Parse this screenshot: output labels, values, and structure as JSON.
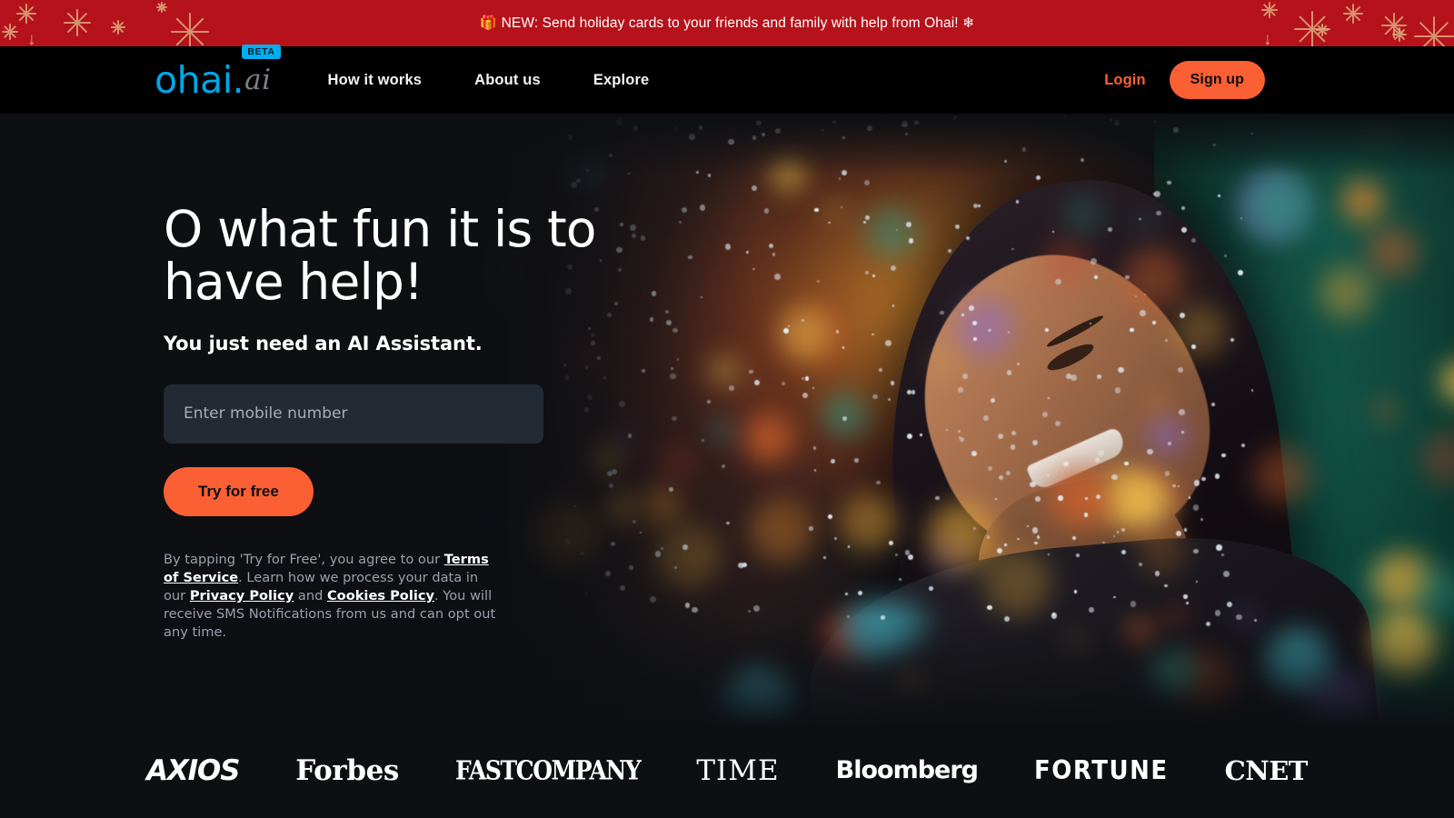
{
  "promo": {
    "icon_left": "gift-icon",
    "text": "🎁 NEW: Send holiday cards to your friends and family with help from Ohai! ❄",
    "background": "#b5121b",
    "decoration_color": "#dca97e"
  },
  "nav": {
    "logo": {
      "name": "ohai",
      "suffix": ".ai",
      "badge": "BETA",
      "brand_color": "#00a7e6",
      "badge_color": "#00aeef"
    },
    "links": [
      {
        "label": "How it works"
      },
      {
        "label": "About us"
      },
      {
        "label": "Explore"
      }
    ],
    "login_label": "Login",
    "signup_label": "Sign up",
    "accent_color": "#fb5f34"
  },
  "hero": {
    "headline": "O what fun it is to\nhave help!",
    "subhead": "You just need an AI Assistant.",
    "phone_placeholder": "Enter mobile number",
    "phone_value": "",
    "cta_label": "Try for free",
    "legal": {
      "part1": "By tapping 'Try for Free', you agree to our ",
      "link1": "Terms of Service",
      "part2": ". Learn how we process your data in our ",
      "link2": "Privacy Policy",
      "part3": " and ",
      "link3": "Cookies Policy",
      "part4": ". You will receive SMS Notifications from us and can opt out any time."
    }
  },
  "press": {
    "logos": [
      {
        "label": "AXIOS",
        "style": "pl-axios"
      },
      {
        "label": "Forbes",
        "style": "pl-forbes"
      },
      {
        "label": "FASTCOMPANY",
        "style": "pl-fastcompany"
      },
      {
        "label": "TIME",
        "style": "pl-time"
      },
      {
        "label": "Bloomberg",
        "style": "pl-bloomberg"
      },
      {
        "label": "FORTUNE",
        "style": "pl-fortune"
      },
      {
        "label": "CNET",
        "style": "pl-cnet"
      }
    ]
  }
}
